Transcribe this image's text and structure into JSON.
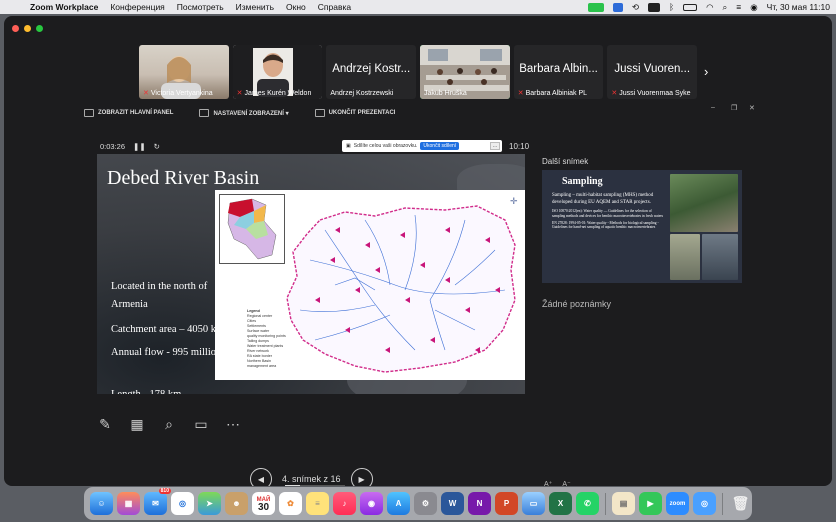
{
  "menubar": {
    "app_name": "Zoom Workplace",
    "menus": [
      "Конференция",
      "Посмотреть",
      "Изменить",
      "Окно",
      "Справка"
    ],
    "clock": "Чт, 30 мая  11:10"
  },
  "participants": [
    {
      "name": "Victoria Vertyankina",
      "muted": true,
      "video": true
    },
    {
      "name": "James Kurén Weldon",
      "muted": true,
      "video": true
    },
    {
      "name": "Andrzej Kostrzewski",
      "short": "Andrzej Kostr...",
      "muted": false,
      "video": false
    },
    {
      "name": "Jakub Hruška",
      "muted": false,
      "video": true,
      "active": true
    },
    {
      "name": "Barbara Albiniak PL",
      "short": "Barbara Albin...",
      "muted": true,
      "video": false
    },
    {
      "name": "Jussi Vuorenmaa Syke",
      "short": "Jussi Vuoren...",
      "muted": true,
      "video": false
    }
  ],
  "share_toolbar": {
    "show_main_panel": "ZOBRAZIT HLAVNÍ PANEL",
    "display_settings": "NASTAVENÍ ZOBRAZENÍ ▾",
    "end_presentation": "UKONČIT PREZENTACI"
  },
  "presenter": {
    "elapsed": "0:03:26",
    "clock": "10:10",
    "share_notice": "Sdílíte celou vaši obrazovku.",
    "stop_share": "Ukončit sdílení",
    "next_label": "Další snímek",
    "notes": "Žádné poznámky",
    "slide_counter": "4. snímek z 16"
  },
  "slide": {
    "title": "Debed River Basin",
    "lines": [
      "Located in the north of Armenia",
      "Catchment area – 4050 km²",
      "Annual flow - 995 million m³",
      "Length - 178 km"
    ],
    "legend": [
      "Legend",
      "Regional center",
      "Cities",
      "Settlements",
      "Surface water",
      "quality monitoring points",
      "Tailing dumps",
      "Water treatment plants",
      "River network",
      "RA state border",
      "Northern Basin",
      "management area"
    ]
  },
  "next_slide": {
    "title": "Sampling",
    "bullet": "Sampling – multi-habitat sampling (MHS) method developed during EU AQEM and STAR projects.",
    "refs": [
      "ISO 10870:2012(en): Water quality — Guidelines for the selection of sampling methods and devices for benthic macroinvertebrates in fresh waters",
      "EN 27828: 1994-05-01: Water quality - Methods for biological sampling - Guidelines for hand-net sampling of aquatic benthic macroinvertebrates"
    ]
  },
  "dock": {
    "mail_badge": "810",
    "calendar_month": "МАЙ",
    "calendar_day": "30",
    "zoom_label": "zoom"
  },
  "colors": {
    "active_border": "#23c552",
    "stop_share_button": "#1f6fe0",
    "window_bg": "#1c1c1e"
  }
}
